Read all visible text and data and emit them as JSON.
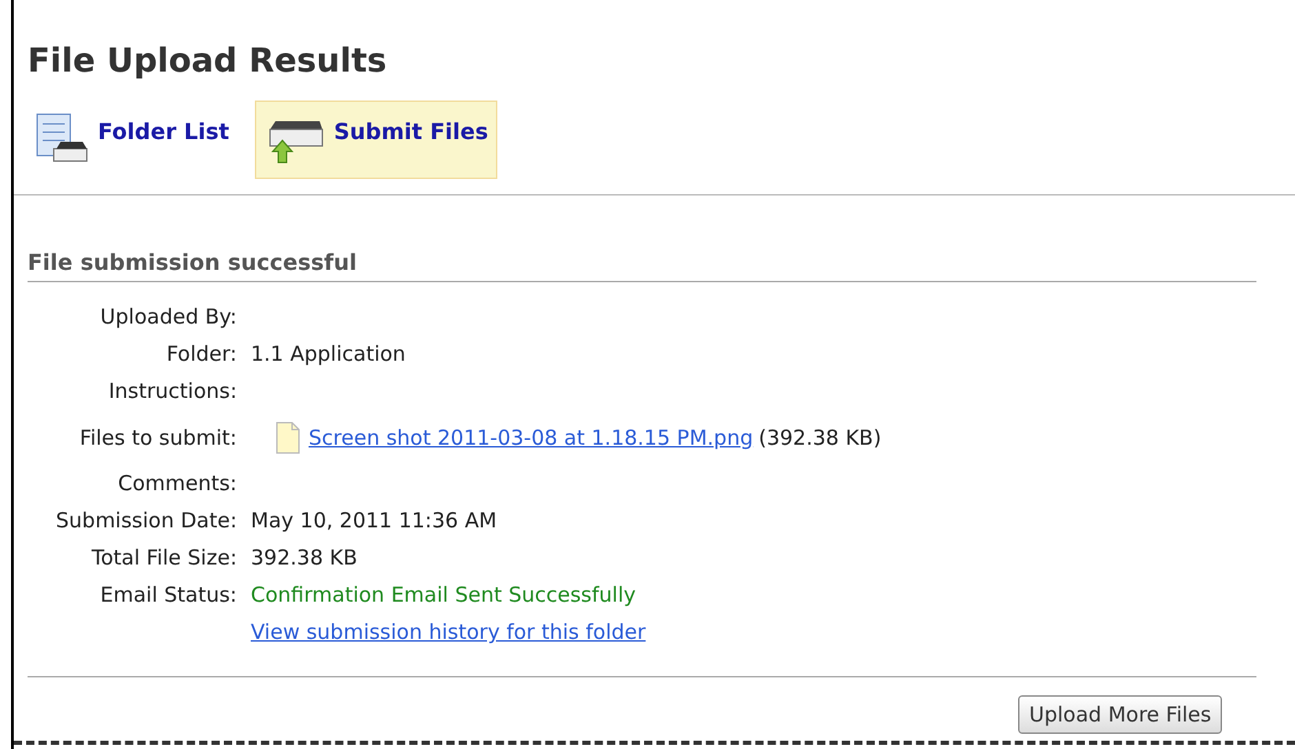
{
  "page": {
    "title": "File Upload Results"
  },
  "tabs": [
    {
      "label": "Folder List",
      "kind": "list",
      "selected": false
    },
    {
      "label": "Submit Files",
      "kind": "upload",
      "selected": true
    }
  ],
  "section": {
    "heading": "File submission successful"
  },
  "rows": [
    {
      "kind": "text",
      "label": "Uploaded By:"
    },
    {
      "kind": "text",
      "label": "Folder:",
      "value": "1.1 Application"
    },
    {
      "kind": "text",
      "label": "Instructions:"
    },
    {
      "kind": "file",
      "label": "Files to submit:",
      "file_name": "Screen shot 2011-03-08 at 1.18.15 PM.png",
      "file_size": "(392.38 KB)"
    },
    {
      "kind": "text",
      "label": "Comments:"
    },
    {
      "kind": "text",
      "label": "Submission Date:",
      "value": "May 10, 2011 11:36 AM"
    },
    {
      "kind": "text",
      "label": "Total File Size:",
      "value": "392.38 KB"
    },
    {
      "kind": "status",
      "label": "Email Status:",
      "value": "Confirmation Email Sent Successfully"
    },
    {
      "kind": "link",
      "value": "View submission history for this folder"
    }
  ],
  "button": "Upload More Files"
}
